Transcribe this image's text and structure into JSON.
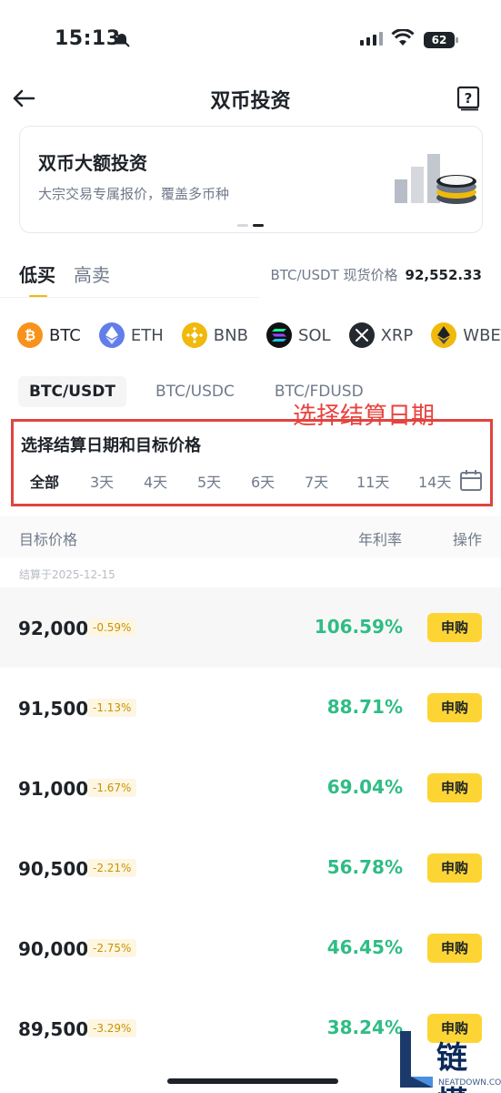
{
  "status_bar": {
    "time": "15:13",
    "battery": "62"
  },
  "header": {
    "title": "双币投资"
  },
  "banner": {
    "title": "双币大额投资",
    "subtitle": "大宗交易专属报价，覆盖多币种"
  },
  "direction_tabs": [
    {
      "label": "低买",
      "active": true
    },
    {
      "label": "高卖",
      "active": false
    }
  ],
  "spot_price": {
    "label": "BTC/USDT 现货价格",
    "value": "92,552.33"
  },
  "coins": [
    {
      "symbol": "BTC",
      "icon": "bitcoin-icon",
      "color": "#f7931a",
      "active": true
    },
    {
      "symbol": "ETH",
      "icon": "ethereum-icon",
      "color": "#627eea",
      "active": false
    },
    {
      "symbol": "BNB",
      "icon": "bnb-icon",
      "color": "#f0b90b",
      "active": false
    },
    {
      "symbol": "SOL",
      "icon": "solana-icon",
      "color": "#111111",
      "active": false
    },
    {
      "symbol": "XRP",
      "icon": "xrp-icon",
      "color": "#23292f",
      "active": false
    },
    {
      "symbol": "WBET",
      "icon": "wbeth-icon",
      "color": "#f0b90b",
      "active": false
    }
  ],
  "pairs": [
    {
      "label": "BTC/USDT",
      "active": true
    },
    {
      "label": "BTC/USDC",
      "active": false
    },
    {
      "label": "BTC/FDUSD",
      "active": false
    }
  ],
  "annotation": "选择结算日期",
  "date_selector": {
    "title": "选择结算日期和目标价格",
    "options": [
      "全部",
      "3天",
      "4天",
      "5天",
      "6天",
      "7天",
      "11天",
      "14天"
    ]
  },
  "table": {
    "headers": {
      "target": "目标价格",
      "apr": "年利率",
      "action": "操作"
    },
    "settlement_label": "结算于2025-12-15",
    "rows": [
      {
        "price": "92,000",
        "diff": "-0.59%",
        "apr": "106.59%",
        "action": "申购"
      },
      {
        "price": "91,500",
        "diff": "-1.13%",
        "apr": "88.71%",
        "action": "申购"
      },
      {
        "price": "91,000",
        "diff": "-1.67%",
        "apr": "69.04%",
        "action": "申购"
      },
      {
        "price": "90,500",
        "diff": "-2.21%",
        "apr": "56.78%",
        "action": "申购"
      },
      {
        "price": "90,000",
        "diff": "-2.75%",
        "apr": "46.45%",
        "action": "申购"
      },
      {
        "price": "89,500",
        "diff": "-3.29%",
        "apr": "38.24%",
        "action": "申购"
      }
    ]
  },
  "watermark": {
    "text": "链懂",
    "sub": "NEATDOWN.COM"
  },
  "colors": {
    "accent": "#fcd535",
    "positive": "#2ebd85",
    "annotation": "#e0443f"
  }
}
